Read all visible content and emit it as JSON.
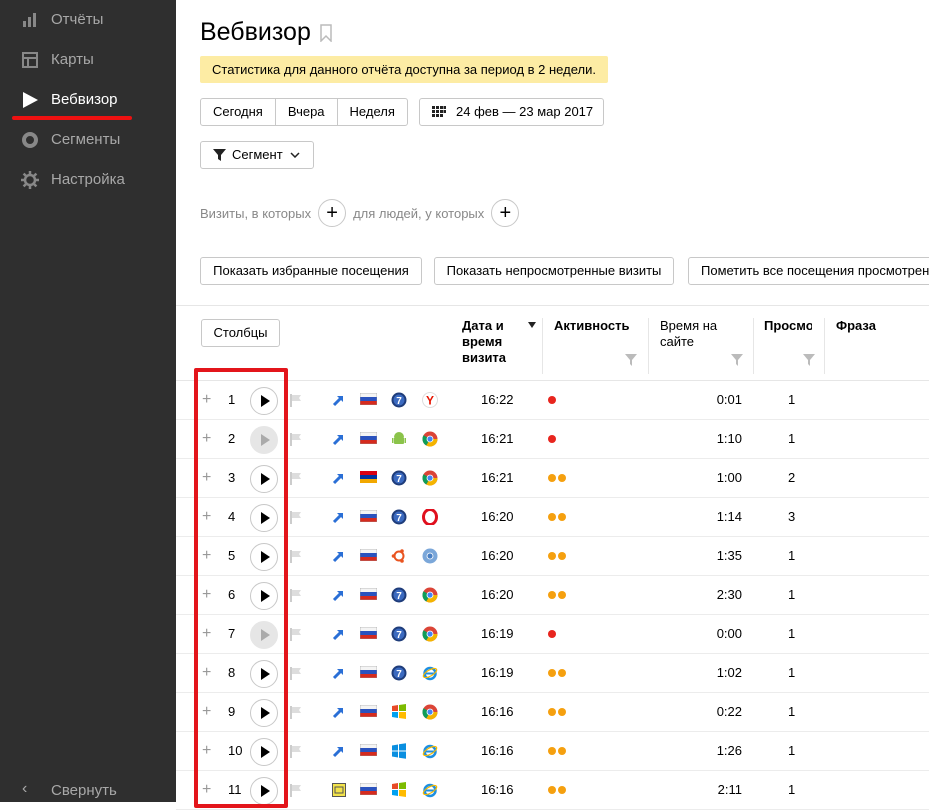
{
  "sidebar": {
    "items": [
      {
        "label": "Отчёты",
        "icon": "bar-chart-icon"
      },
      {
        "label": "Карты",
        "icon": "map-icon"
      },
      {
        "label": "Вебвизор",
        "icon": "play-icon"
      },
      {
        "label": "Сегменты",
        "icon": "segments-icon"
      },
      {
        "label": "Настройка",
        "icon": "gear-icon"
      }
    ],
    "active_index": 2,
    "collapse_label": "Свернуть"
  },
  "page": {
    "title": "Вебвизор",
    "notice": "Статистика для данного отчёта доступна за период в 2 недели.",
    "periods": [
      "Сегодня",
      "Вчера",
      "Неделя"
    ],
    "date_range": "24 фев — 23 мар 2017",
    "segment_label": "Сегмент",
    "filter_visits": "Визиты, в которых",
    "filter_people": "для людей, у которых",
    "actions": [
      "Показать избранные посещения",
      "Показать непросмотренные визиты",
      "Пометить все посещения просмотрен"
    ],
    "columns_button": "Столбцы"
  },
  "table": {
    "headers": {
      "datetime": "Дата и время визита",
      "activity": "Активность",
      "duration": "Время на сайте",
      "views": "Просмо",
      "phrase": "Фраза"
    },
    "rows": [
      {
        "n": "1",
        "viewed": false,
        "src": "link",
        "country": "ru",
        "os": "win7",
        "browser": "yandex",
        "time": "16:22",
        "activity": 1,
        "duration": "0:01",
        "views": "1"
      },
      {
        "n": "2",
        "viewed": true,
        "src": "link",
        "country": "ru",
        "os": "android",
        "browser": "chrome",
        "time": "16:21",
        "activity": 1,
        "duration": "1:10",
        "views": "1"
      },
      {
        "n": "3",
        "viewed": false,
        "src": "link",
        "country": "am",
        "os": "win7",
        "browser": "chrome",
        "time": "16:21",
        "activity": 2,
        "duration": "1:00",
        "views": "2"
      },
      {
        "n": "4",
        "viewed": false,
        "src": "link",
        "country": "ru",
        "os": "win7",
        "browser": "opera",
        "time": "16:20",
        "activity": 2,
        "duration": "1:14",
        "views": "3"
      },
      {
        "n": "5",
        "viewed": false,
        "src": "link",
        "country": "ru",
        "os": "ubuntu",
        "browser": "chromium",
        "time": "16:20",
        "activity": 2,
        "duration": "1:35",
        "views": "1"
      },
      {
        "n": "6",
        "viewed": false,
        "src": "link",
        "country": "ru",
        "os": "win7",
        "browser": "chrome",
        "time": "16:20",
        "activity": 2,
        "duration": "2:30",
        "views": "1"
      },
      {
        "n": "7",
        "viewed": true,
        "src": "link",
        "country": "ru",
        "os": "win7",
        "browser": "chrome",
        "time": "16:19",
        "activity": 1,
        "duration": "0:00",
        "views": "1"
      },
      {
        "n": "8",
        "viewed": false,
        "src": "link",
        "country": "ru",
        "os": "win7",
        "browser": "ie",
        "time": "16:19",
        "activity": 2,
        "duration": "1:02",
        "views": "1"
      },
      {
        "n": "9",
        "viewed": false,
        "src": "link",
        "country": "ru",
        "os": "winxp",
        "browser": "chrome",
        "time": "16:16",
        "activity": 2,
        "duration": "0:22",
        "views": "1"
      },
      {
        "n": "10",
        "viewed": false,
        "src": "link",
        "country": "ru",
        "os": "win10",
        "browser": "ie",
        "time": "16:16",
        "activity": 2,
        "duration": "1:26",
        "views": "1"
      },
      {
        "n": "11",
        "viewed": false,
        "src": "ad",
        "country": "ru",
        "os": "winxp",
        "browser": "ie",
        "time": "16:16",
        "activity": 2,
        "duration": "2:11",
        "views": "1"
      }
    ]
  },
  "colors": {
    "sidebar_bg": "#2f2f2f",
    "active_underline": "#e11",
    "notice_bg": "#fdeca4",
    "activity_low": "#e8251e",
    "activity_mid": "#f5a00f",
    "highlight_frame": "#e3151b"
  }
}
